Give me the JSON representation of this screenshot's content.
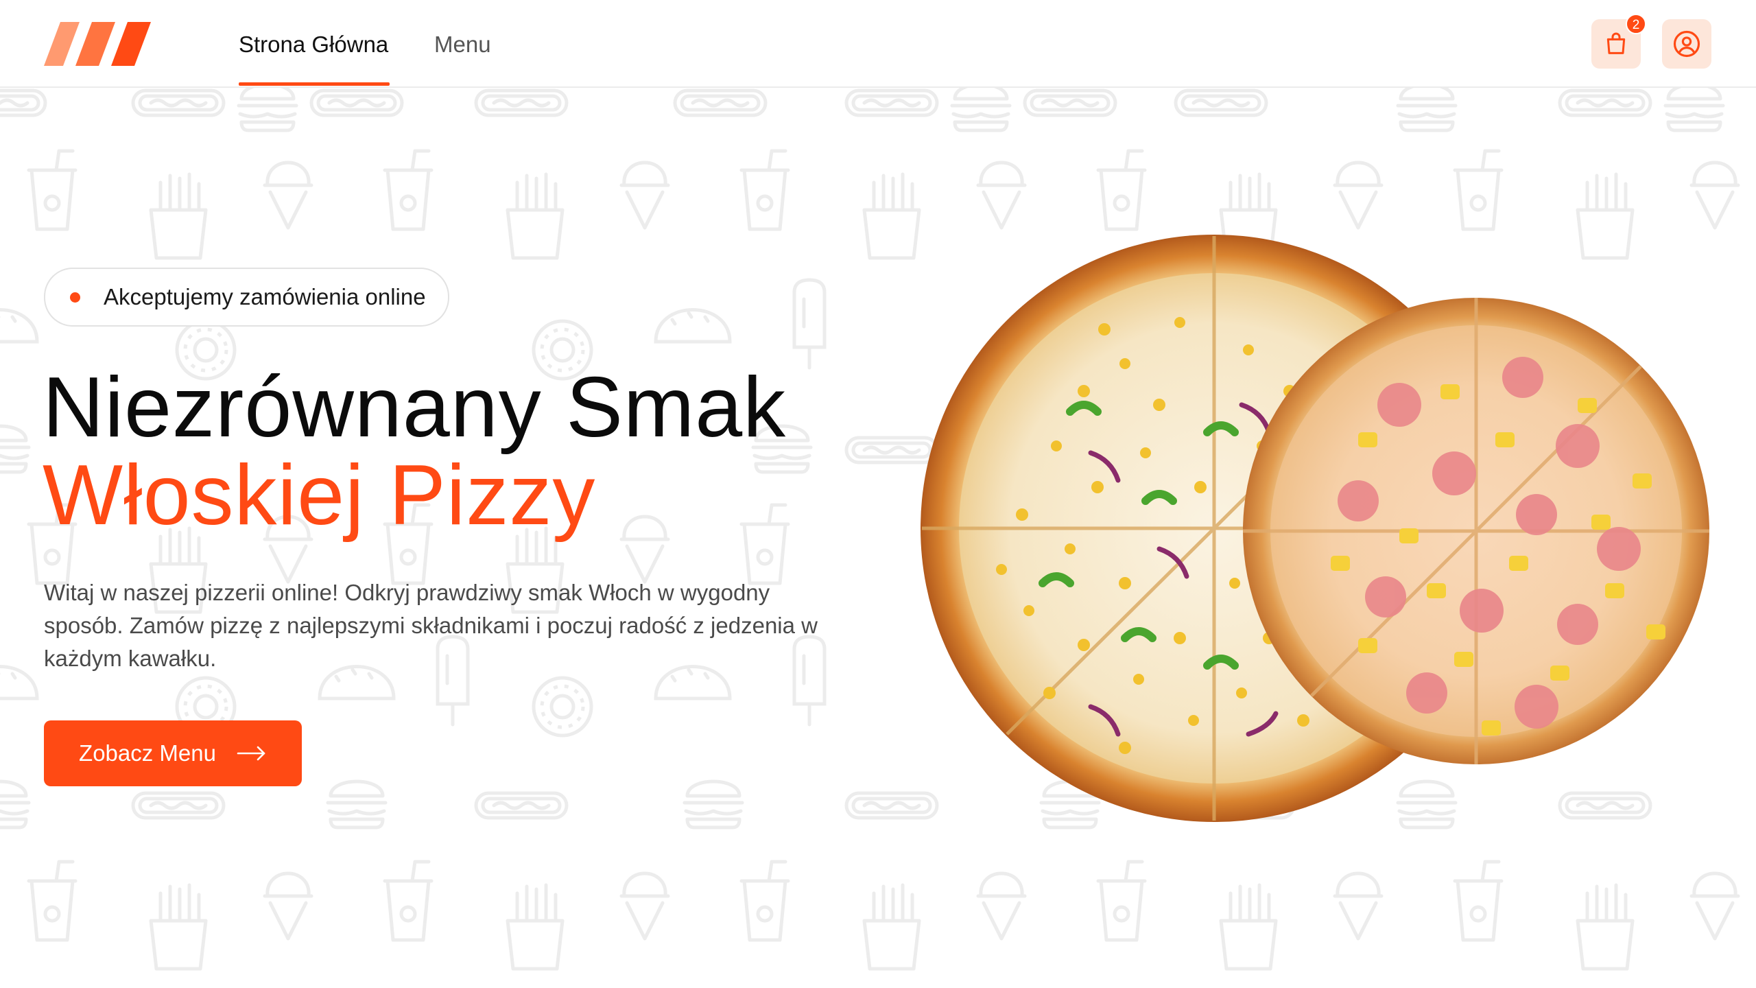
{
  "header": {
    "logo": "brand-logo-stripes",
    "nav": [
      {
        "label": "Strona Główna",
        "active": true
      },
      {
        "label": "Menu",
        "active": false
      }
    ],
    "cart": {
      "icon": "shopping-bag-icon",
      "count": "2"
    },
    "user": {
      "icon": "user-circle-icon"
    }
  },
  "hero": {
    "badge": "Akceptujemy zamówienia online",
    "title_line1": "Niezrównany Smak",
    "title_line2": "Włoskiej Pizzy",
    "description": "Witaj w naszej pizzerii online! Odkryj prawdziwy smak Włoch w wygodny sposób. Zamów pizzę z najlepszymi składnikami i poczuj radość z jedzenia w każdym kawałku.",
    "cta_label": "Zobacz Menu",
    "image": "two-pizzas"
  },
  "colors": {
    "accent": "#ff4a14",
    "accent_light": "#fde6da",
    "background": "#ffffff",
    "pattern": "#ededed"
  }
}
